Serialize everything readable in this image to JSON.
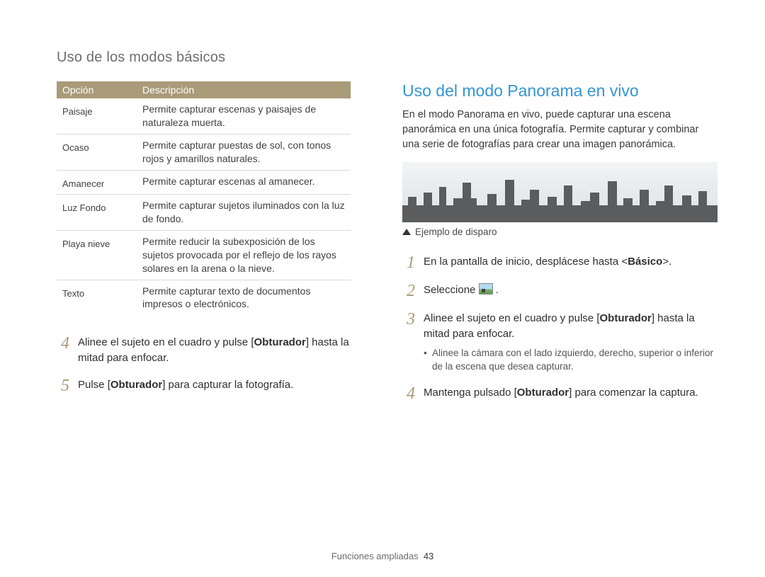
{
  "page": {
    "breadcrumb": "Uso de los modos básicos",
    "footer_label": "Funciones ampliadas",
    "page_number": "43"
  },
  "table": {
    "head_option": "Opción",
    "head_desc": "Descripción",
    "rows": [
      {
        "option": "Paisaje",
        "desc": "Permite capturar escenas y paisajes de naturaleza muerta."
      },
      {
        "option": "Ocaso",
        "desc": "Permite capturar puestas de sol, con tonos rojos y amarillos naturales."
      },
      {
        "option": "Amanecer",
        "desc": "Permite capturar escenas al amanecer."
      },
      {
        "option": "Luz Fondo",
        "desc": "Permite capturar sujetos iluminados con la luz de fondo."
      },
      {
        "option": "Playa nieve",
        "desc": "Permite reducir la subexposición de los sujetos provocada por el reflejo de los rayos solares en la arena o la nieve."
      },
      {
        "option": "Texto",
        "desc": "Permite capturar texto de documentos impresos o electrónicos."
      }
    ]
  },
  "left_steps": {
    "s4": {
      "num": "4",
      "pre": "Alinee el sujeto en el cuadro y pulse [",
      "bold": "Obturador",
      "post": "] hasta la mitad para enfocar."
    },
    "s5": {
      "num": "5",
      "pre": "Pulse [",
      "bold": "Obturador",
      "post": "] para capturar la fotografía."
    }
  },
  "right": {
    "heading": "Uso del modo Panorama en vivo",
    "intro": "En el modo Panorama en vivo, puede capturar una escena panorámica en una única fotografía. Permite capturar y combinar una serie de fotografías para crear una imagen panorámica.",
    "caption": "Ejemplo de disparo",
    "s1": {
      "num": "1",
      "pre": "En la pantalla de inicio, desplácese hasta <",
      "bold": "Básico",
      "post": ">."
    },
    "s2": {
      "num": "2",
      "pre": "Seleccione ",
      "post": " ."
    },
    "s3": {
      "num": "3",
      "pre": "Alinee el sujeto en el cuadro y pulse [",
      "bold": "Obturador",
      "post": "] hasta la mitad para enfocar.",
      "sub": "Alinee la cámara con el lado izquierdo, derecho, superior o inferior de la escena que desea capturar."
    },
    "s4": {
      "num": "4",
      "pre": "Mantenga pulsado [",
      "bold": "Obturador",
      "post": "] para comenzar la captura."
    }
  }
}
